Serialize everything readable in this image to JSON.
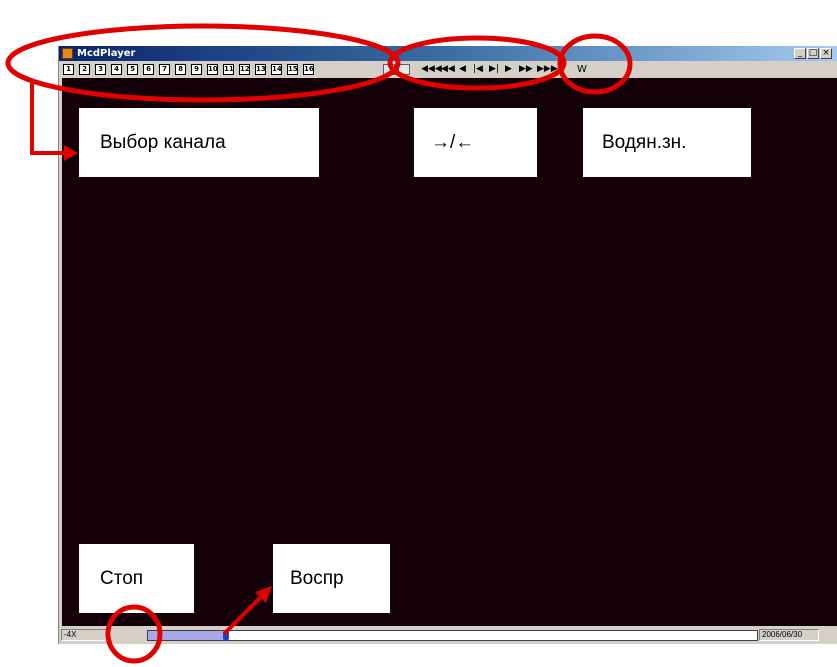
{
  "window": {
    "title": "McdPlayer",
    "controls": [
      "_",
      "□",
      "×"
    ]
  },
  "toolbar": {
    "channels": [
      "1",
      "2",
      "3",
      "4",
      "5",
      "6",
      "7",
      "8",
      "9",
      "10",
      "11",
      "12",
      "13",
      "14",
      "15",
      "16"
    ],
    "navigation": [
      "◀◀◀",
      "◀◀",
      "◀",
      "|◀",
      "▶|",
      "▶",
      "▶▶",
      "▶▶▶"
    ],
    "watermark_label": "W"
  },
  "status": {
    "speed": "-4X",
    "date": "2006/06/30",
    "progress_fraction": 0.13
  },
  "annotations": {
    "channel_select": "Выбор канала",
    "direction": "→/←",
    "watermark": "Водян.зн.",
    "stop": "Стоп",
    "play": "Воспр"
  },
  "colors": {
    "annotation": "#e00000",
    "video_background": "#130008",
    "timeline_fill": "#a9a8e6"
  }
}
